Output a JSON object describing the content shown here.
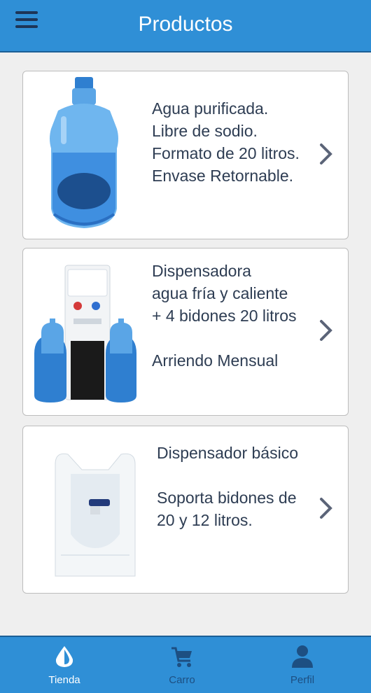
{
  "header": {
    "title": "Productos"
  },
  "products": [
    {
      "lines": "Agua purificada.\nLibre de sodio.\nFormato de 20 litros.\nEnvase Retornable."
    },
    {
      "lines": "Dispensadora\nagua fría y caliente\n+ 4 bidones 20 litros\n\nArriendo Mensual"
    },
    {
      "lines": "Dispensador básico\n\nSoporta bidones de\n20 y 12 litros."
    }
  ],
  "tabs": [
    {
      "label": "Tienda",
      "icon": "water-drop-icon",
      "active": true
    },
    {
      "label": "Carro",
      "icon": "cart-icon",
      "active": false
    },
    {
      "label": "Perfil",
      "icon": "person-icon",
      "active": false
    }
  ],
  "colors": {
    "primary": "#2f8fd6",
    "text": "#2e3d53",
    "inactive_tab": "#1d4f82"
  }
}
